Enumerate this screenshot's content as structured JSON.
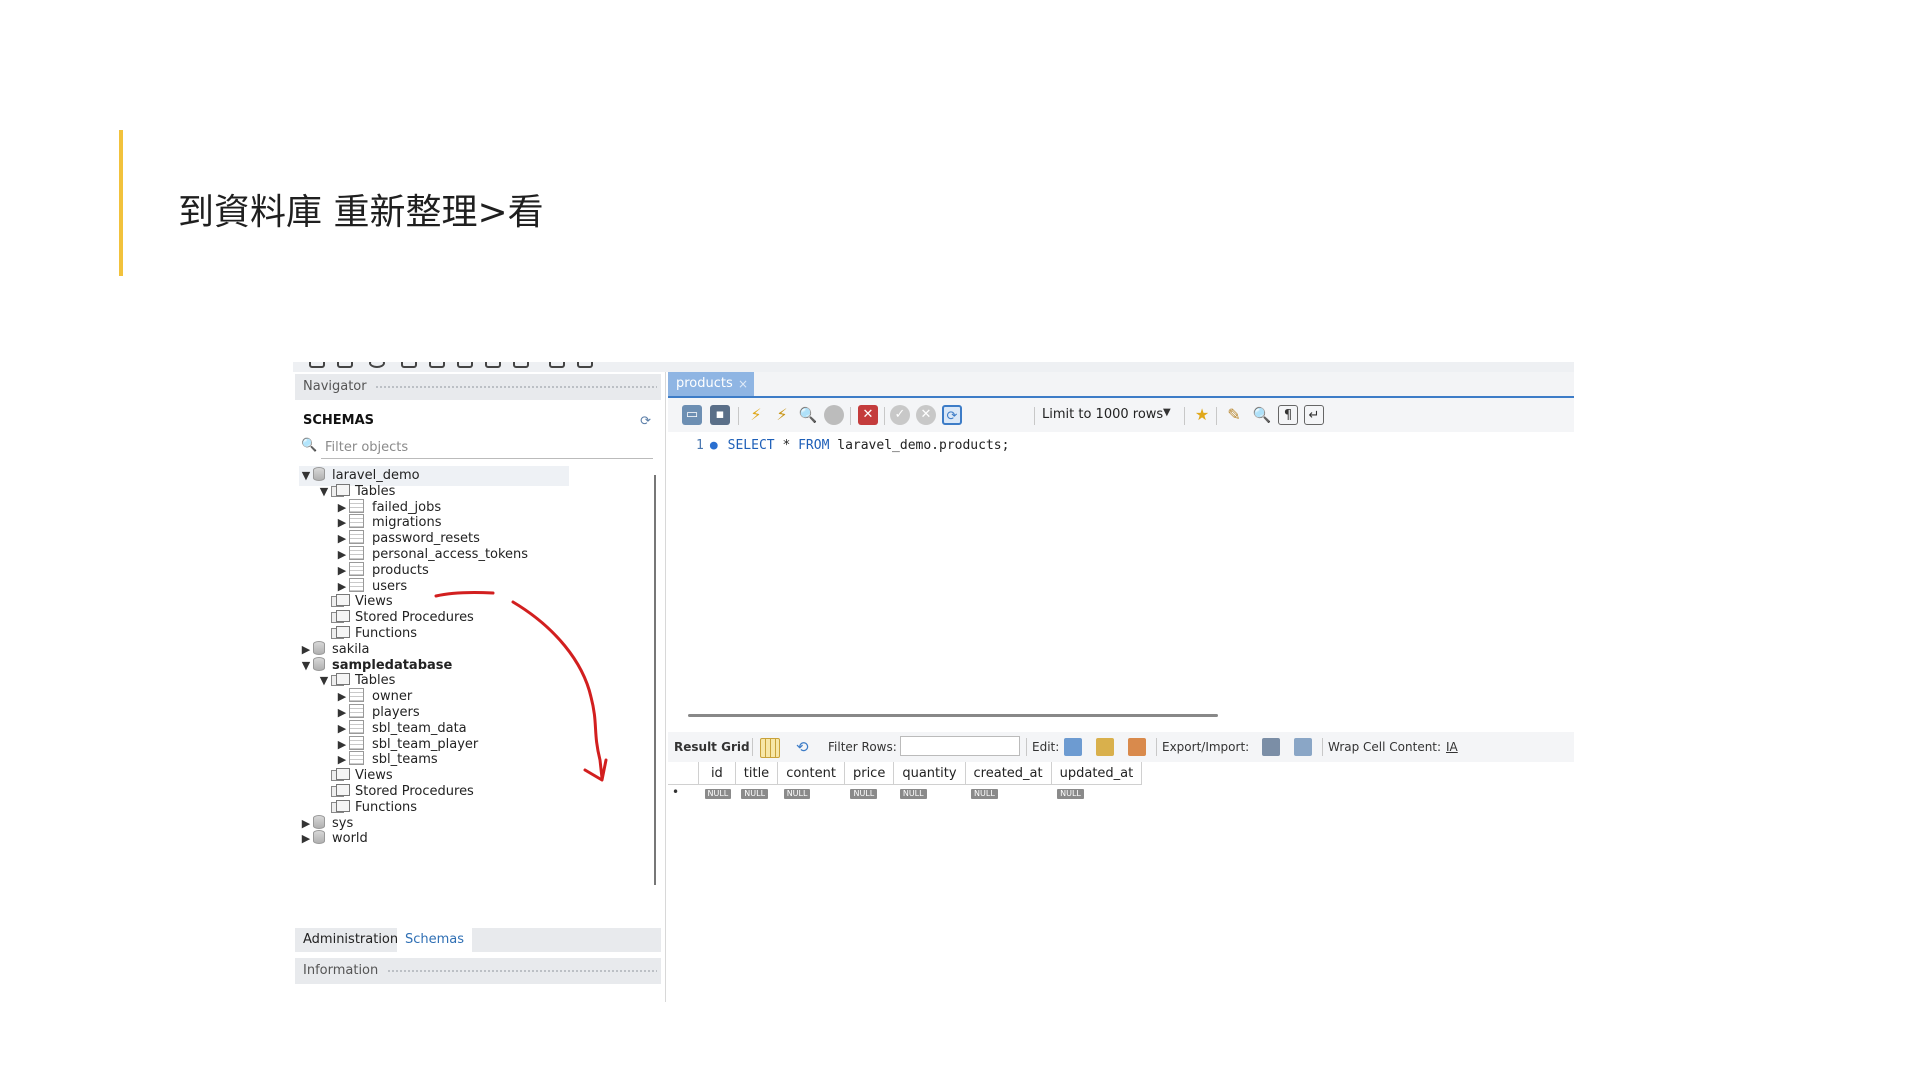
{
  "slide": {
    "title": "到資料庫 重新整理>看",
    "accent_color": "#f2c23c"
  },
  "navigator": {
    "title": "Navigator",
    "schemas_label": "SCHEMAS",
    "filter_placeholder": "Filter objects",
    "tree": [
      {
        "label": "laravel_demo",
        "type": "schema",
        "expanded": true,
        "bold": false
      },
      {
        "label": "Tables",
        "type": "folder",
        "expanded": true
      },
      {
        "label": "failed_jobs",
        "type": "table"
      },
      {
        "label": "migrations",
        "type": "table"
      },
      {
        "label": "password_resets",
        "type": "table"
      },
      {
        "label": "personal_access_tokens",
        "type": "table"
      },
      {
        "label": "products",
        "type": "table"
      },
      {
        "label": "users",
        "type": "table"
      },
      {
        "label": "Views",
        "type": "folder"
      },
      {
        "label": "Stored Procedures",
        "type": "folder"
      },
      {
        "label": "Functions",
        "type": "folder"
      },
      {
        "label": "sakila",
        "type": "schema",
        "expanded": false
      },
      {
        "label": "sampledatabase",
        "type": "schema",
        "expanded": true,
        "bold": true
      },
      {
        "label": "Tables",
        "type": "folder",
        "expanded": true
      },
      {
        "label": "owner",
        "type": "table"
      },
      {
        "label": "players",
        "type": "table"
      },
      {
        "label": "sbl_team_data",
        "type": "table"
      },
      {
        "label": "sbl_team_player",
        "type": "table"
      },
      {
        "label": "sbl_teams",
        "type": "table"
      },
      {
        "label": "Views",
        "type": "folder"
      },
      {
        "label": "Stored Procedures",
        "type": "folder"
      },
      {
        "label": "Functions",
        "type": "folder"
      },
      {
        "label": "sys",
        "type": "schema",
        "expanded": false
      },
      {
        "label": "world",
        "type": "schema",
        "expanded": false
      }
    ],
    "bottom_tabs": [
      "Administration",
      "Schemas"
    ],
    "active_tab": "Schemas",
    "information_label": "Information"
  },
  "editor": {
    "tab_label": "products",
    "tab_close": "×",
    "limit_label": "Limit to 1000 rows",
    "line_number": "1",
    "sql": {
      "kw1": "SELECT",
      "star": " * ",
      "kw2": "FROM",
      "rest": " laravel_demo.products;"
    }
  },
  "result": {
    "result_grid_label": "Result Grid",
    "filter_rows_label": "Filter Rows:",
    "edit_label": "Edit:",
    "export_label": "Export/Import:",
    "wrap_label": "Wrap Cell Content:",
    "columns": [
      "id",
      "title",
      "content",
      "price",
      "quantity",
      "created_at",
      "updated_at"
    ],
    "null_text": "NULL",
    "row_marker": "•"
  },
  "colors": {
    "annotation": "#d21f1f",
    "tab_active": "#8fb5e3",
    "keyword": "#1e5fb8"
  }
}
